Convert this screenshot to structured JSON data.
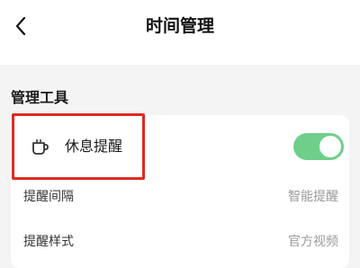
{
  "header": {
    "title": "时间管理",
    "back_icon": "chevron-left-icon"
  },
  "section": {
    "title": "管理工具"
  },
  "break_reminder": {
    "label": "休息提醒",
    "icon": "cup-icon",
    "enabled": true,
    "toggle_color": "#6fcf8a"
  },
  "settings": [
    {
      "label": "提醒间隔",
      "value": "智能提醒"
    },
    {
      "label": "提醒样式",
      "value": "官方视频"
    }
  ],
  "annotation": {
    "highlight_color": "#e02a20"
  }
}
